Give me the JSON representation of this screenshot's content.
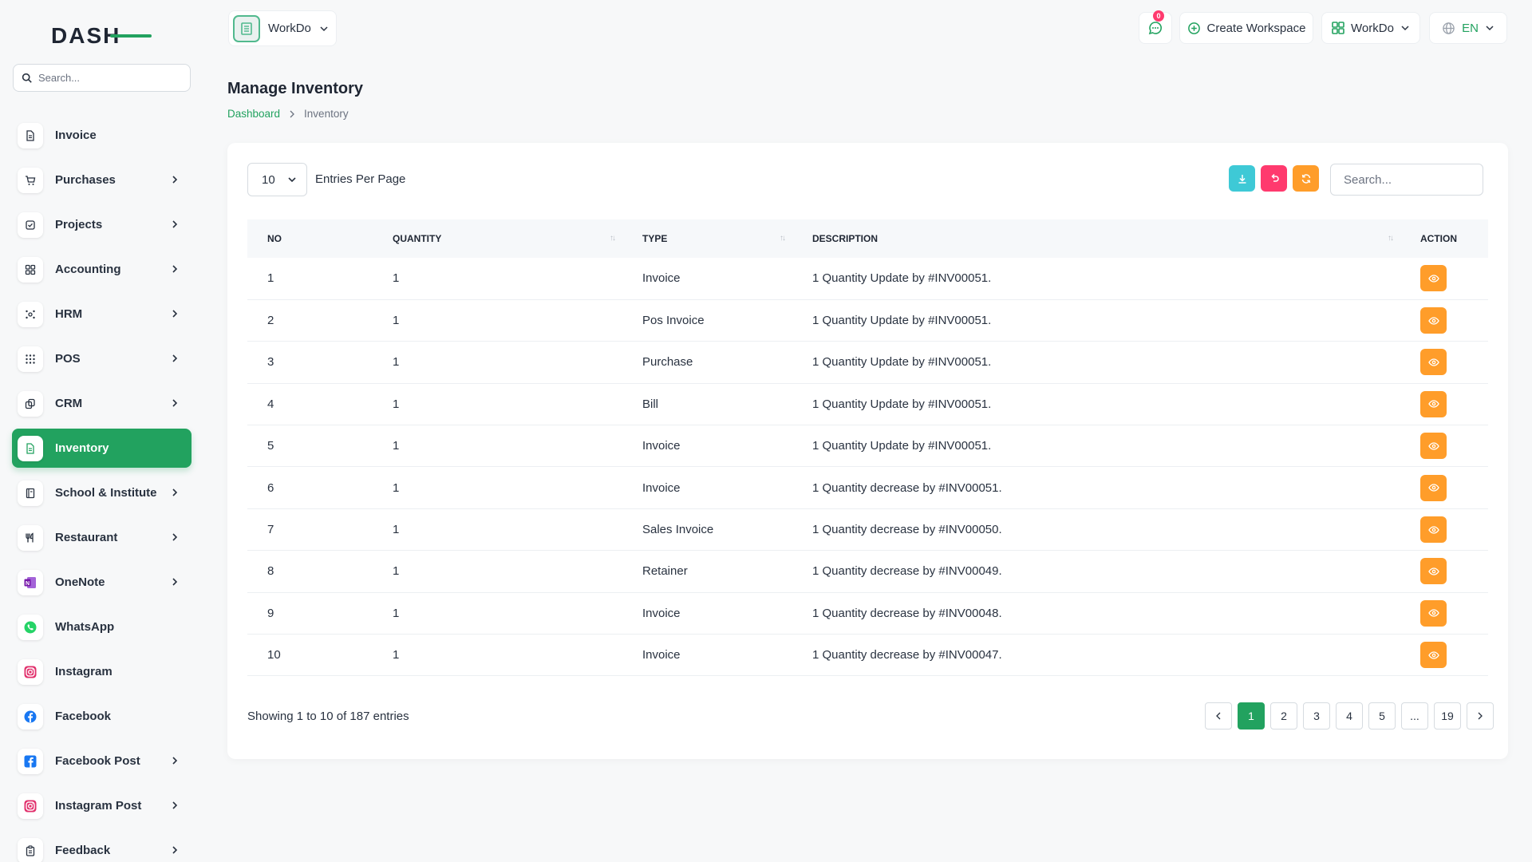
{
  "brand": {
    "logo_text": "DASH"
  },
  "sidebar": {
    "search_placeholder": "Search...",
    "items": [
      {
        "label": "Invoice",
        "icon": "file-icon",
        "submenu": false,
        "active": false
      },
      {
        "label": "Purchases",
        "icon": "cart-icon",
        "submenu": true,
        "active": false
      },
      {
        "label": "Projects",
        "icon": "check-square-icon",
        "submenu": true,
        "active": false
      },
      {
        "label": "Accounting",
        "icon": "grid-icon",
        "submenu": true,
        "active": false
      },
      {
        "label": "HRM",
        "icon": "users-icon",
        "submenu": true,
        "active": false
      },
      {
        "label": "POS",
        "icon": "dots-grid-icon",
        "submenu": true,
        "active": false
      },
      {
        "label": "CRM",
        "icon": "layers-icon",
        "submenu": true,
        "active": false
      },
      {
        "label": "Inventory",
        "icon": "file-icon",
        "submenu": false,
        "active": true
      },
      {
        "label": "School & Institute",
        "icon": "book-icon",
        "submenu": true,
        "active": false
      },
      {
        "label": "Restaurant",
        "icon": "fork-knife-icon",
        "submenu": true,
        "active": false
      },
      {
        "label": "OneNote",
        "icon": "onenote-icon",
        "submenu": true,
        "active": false
      },
      {
        "label": "WhatsApp",
        "icon": "whatsapp-icon",
        "submenu": false,
        "active": false
      },
      {
        "label": "Instagram",
        "icon": "instagram-icon",
        "submenu": false,
        "active": false
      },
      {
        "label": "Facebook",
        "icon": "facebook-icon",
        "submenu": false,
        "active": false
      },
      {
        "label": "Facebook Post",
        "icon": "facebook-post-icon",
        "submenu": true,
        "active": false
      },
      {
        "label": "Instagram Post",
        "icon": "instagram-icon",
        "submenu": true,
        "active": false
      },
      {
        "label": "Feedback",
        "icon": "clipboard-icon",
        "submenu": true,
        "active": false
      }
    ]
  },
  "header": {
    "workspace_name": "WorkDo",
    "notification_count": "0",
    "create_workspace_label": "Create Workspace",
    "company_label": "WorkDo",
    "language_label": "EN"
  },
  "page": {
    "title": "Manage Inventory",
    "breadcrumb": {
      "home": "Dashboard",
      "current": "Inventory"
    }
  },
  "table_controls": {
    "per_page_value": "10",
    "per_page_label": "Entries Per Page",
    "search_placeholder": "Search..."
  },
  "table": {
    "columns": [
      "NO",
      "QUANTITY",
      "TYPE",
      "DESCRIPTION",
      "ACTION"
    ],
    "rows": [
      {
        "no": "1",
        "quantity": "1",
        "type": "Invoice",
        "description": "1 Quantity Update by #INV00051."
      },
      {
        "no": "2",
        "quantity": "1",
        "type": "Pos Invoice",
        "description": "1 Quantity Update by #INV00051."
      },
      {
        "no": "3",
        "quantity": "1",
        "type": "Purchase",
        "description": "1 Quantity Update by #INV00051."
      },
      {
        "no": "4",
        "quantity": "1",
        "type": "Bill",
        "description": "1 Quantity Update by #INV00051."
      },
      {
        "no": "5",
        "quantity": "1",
        "type": "Invoice",
        "description": "1 Quantity Update by #INV00051."
      },
      {
        "no": "6",
        "quantity": "1",
        "type": "Invoice",
        "description": "1 Quantity decrease by #INV00051."
      },
      {
        "no": "7",
        "quantity": "1",
        "type": "Sales Invoice",
        "description": "1 Quantity decrease by #INV00050."
      },
      {
        "no": "8",
        "quantity": "1",
        "type": "Retainer",
        "description": "1 Quantity decrease by #INV00049."
      },
      {
        "no": "9",
        "quantity": "1",
        "type": "Invoice",
        "description": "1 Quantity decrease by #INV00048."
      },
      {
        "no": "10",
        "quantity": "1",
        "type": "Invoice",
        "description": "1 Quantity decrease by #INV00047."
      }
    ]
  },
  "footer": {
    "showing_text": "Showing 1 to 10 of 187 entries",
    "pages": [
      "1",
      "2",
      "3",
      "4",
      "5",
      "...",
      "19"
    ],
    "active_page": "1"
  },
  "colors": {
    "primary": "#22a25f",
    "action_orange": "#ff9d2a",
    "export_cyan": "#3ec9d6",
    "reset_pink": "#ff3a6e",
    "refresh_orange": "#ff9d2a"
  }
}
